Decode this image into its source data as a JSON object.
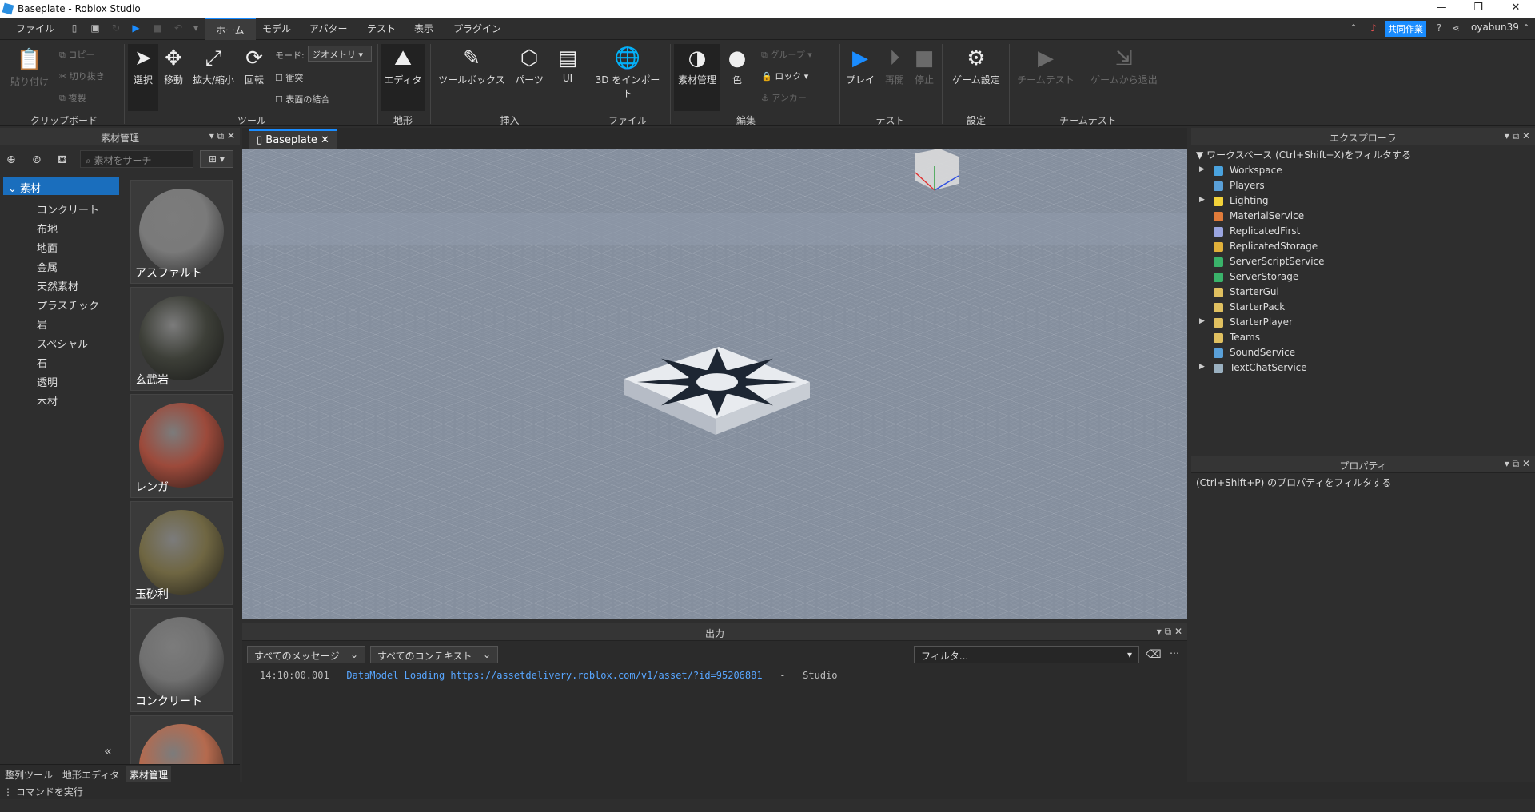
{
  "window": {
    "title": "Baseplate - Roblox Studio",
    "min": "—",
    "max": "❐",
    "close": "✕"
  },
  "menubar": {
    "file": "ファイル",
    "tabs": [
      "ホーム",
      "モデル",
      "アバター",
      "テスト",
      "表示",
      "プラグイン"
    ],
    "collab": "共同作業",
    "user": "oyabun39"
  },
  "ribbon": {
    "paste": "貼り付け",
    "copy": "コピー",
    "cut": "切り抜き",
    "duplicate": "複製",
    "select": "選択",
    "move": "移動",
    "scale": "拡大/縮小",
    "rotate": "回転",
    "mode_label": "モード:",
    "mode_value": "ジオメトリ",
    "collision": "衝突",
    "join": "表面の結合",
    "editor": "エディタ",
    "toolbox": "ツールボックス",
    "parts": "パーツ",
    "ui": "UI",
    "import3d": "3D をインポート",
    "material": "素材管理",
    "color": "色",
    "group": "グループ",
    "lock": "ロック",
    "anchor": "アンカー",
    "play": "プレイ",
    "resume": "再開",
    "stop": "停止",
    "game_settings": "ゲーム設定",
    "team_test": "チームテスト",
    "exit_game": "ゲームから退出",
    "groups": [
      "クリップボード",
      "ツール",
      "地形",
      "挿入",
      "ファイル",
      "編集",
      "テスト",
      "設定",
      "チームテスト"
    ]
  },
  "material_panel": {
    "title": "素材管理",
    "search_placeholder": "素材をサーチ",
    "root": "素材",
    "categories": [
      "コンクリート",
      "布地",
      "地面",
      "金属",
      "天然素材",
      "プラスチック",
      "岩",
      "スペシャル",
      "石",
      "透明",
      "木材"
    ],
    "swatches": [
      {
        "label": "アスファルト",
        "color": "#7a7a7a"
      },
      {
        "label": "玄武岩",
        "color": "#3d3f38"
      },
      {
        "label": "レンガ",
        "color": "#9c4a3b"
      },
      {
        "label": "玉砂利",
        "color": "#6f6642"
      },
      {
        "label": "コンクリート",
        "color": "#707070"
      },
      {
        "label": "",
        "color": "#b56a4e"
      }
    ],
    "bottom_tabs": [
      "整列ツール",
      "地形エディタ",
      "素材管理"
    ]
  },
  "viewport": {
    "tab": "Baseplate"
  },
  "output": {
    "title": "出力",
    "filter_messages": "すべてのメッセージ",
    "filter_context": "すべてのコンテキスト",
    "filter_placeholder": "フィルタ...",
    "log": {
      "time": "14:10:00.001",
      "message": "DataModel Loading https://assetdelivery.roblox.com/v1/asset/?id=95206881",
      "sep": "-",
      "source": "Studio"
    }
  },
  "explorer": {
    "title": "エクスプローラ",
    "filter": "ワークスペース (Ctrl+Shift+X)をフィルタする",
    "items": [
      {
        "name": "Workspace",
        "color": "#4aa3df",
        "expand": true
      },
      {
        "name": "Players",
        "color": "#5aa0d8",
        "expand": false
      },
      {
        "name": "Lighting",
        "color": "#f2d23a",
        "expand": true
      },
      {
        "name": "MaterialService",
        "color": "#e07b3a",
        "expand": false
      },
      {
        "name": "ReplicatedFirst",
        "color": "#9aa5e0",
        "expand": false
      },
      {
        "name": "ReplicatedStorage",
        "color": "#e0b03a",
        "expand": false
      },
      {
        "name": "ServerScriptService",
        "color": "#3ab36a",
        "expand": false
      },
      {
        "name": "ServerStorage",
        "color": "#3ab36a",
        "expand": false
      },
      {
        "name": "StarterGui",
        "color": "#e0c060",
        "expand": false
      },
      {
        "name": "StarterPack",
        "color": "#e0c060",
        "expand": false
      },
      {
        "name": "StarterPlayer",
        "color": "#e0c060",
        "expand": true
      },
      {
        "name": "Teams",
        "color": "#e0c060",
        "expand": false
      },
      {
        "name": "SoundService",
        "color": "#5aa0d8",
        "expand": false
      },
      {
        "name": "TextChatService",
        "color": "#9ab0c0",
        "expand": true
      }
    ]
  },
  "properties": {
    "title": "プロパティ",
    "filter": "(Ctrl+Shift+P) のプロパティをフィルタする"
  },
  "command": {
    "placeholder": "コマンドを実行"
  }
}
